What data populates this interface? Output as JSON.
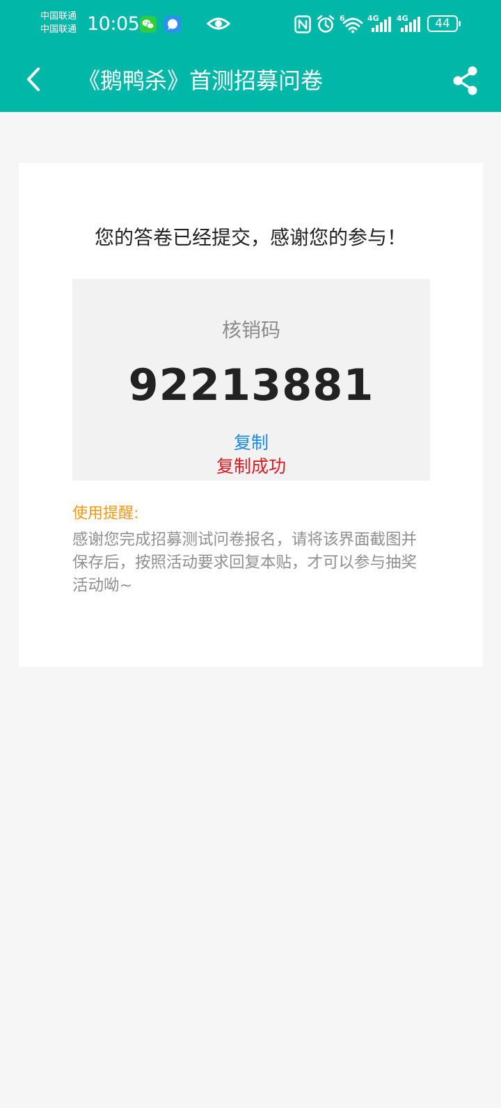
{
  "status_bar": {
    "carrier_1": "中国联通",
    "carrier_2": "中国联通",
    "time": "10:05",
    "wifi_label": "6",
    "signal_1_label": "4G",
    "signal_2_label": "4G",
    "battery": "44"
  },
  "nav": {
    "title": "《鹅鸭杀》首测招募问卷"
  },
  "content": {
    "thanks_message": "您的答卷已经提交，感谢您的参与！",
    "code_label": "核销码",
    "code_value": "92213881",
    "copy_label": "复制",
    "copy_success": "复制成功",
    "tip_title": "使用提醒:",
    "tip_body": "感谢您完成招募测试问卷报名，请将该界面截图并保存后，按照活动要求回复本贴，才可以参与抽奖活动呦~"
  },
  "colors": {
    "header": "#00b7a8",
    "background": "#f6f6f6",
    "copy_link": "#1a8ae0",
    "success": "#e0181e",
    "tip_title": "#f09a17"
  },
  "icons": {
    "back": "chevron-left-icon",
    "share": "share-icon",
    "wechat": "wechat-icon",
    "message": "message-icon",
    "eye": "eye-icon",
    "nfc": "nfc-icon",
    "alarm": "alarm-icon",
    "wifi": "wifi-icon",
    "signal": "signal-icon"
  }
}
